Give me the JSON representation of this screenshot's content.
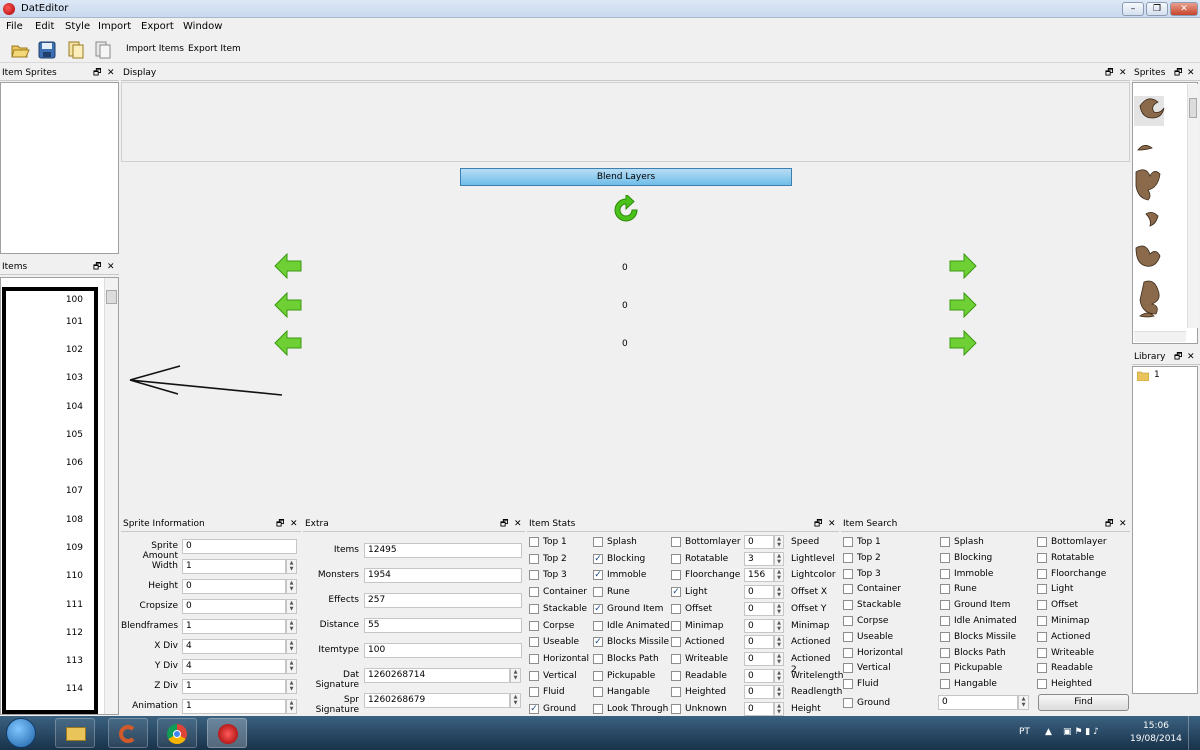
{
  "window": {
    "title": "DatEditor",
    "min_btn": "–",
    "max_btn": "❐",
    "close_btn": "✕"
  },
  "menu": [
    "File",
    "Edit",
    "Style",
    "Import",
    "Export",
    "Window"
  ],
  "toolbar": {
    "import_items": "Import Items",
    "export_item": "Export Item"
  },
  "panels": {
    "item_sprites": "Item Sprites",
    "items": "Items",
    "display": "Display",
    "sprites": "Sprites",
    "library": "Library",
    "sprite_information": "Sprite Information",
    "extra": "Extra",
    "item_stats": "Item Stats",
    "item_search": "Item Search"
  },
  "items_list": [
    "100",
    "101",
    "102",
    "103",
    "104",
    "105",
    "106",
    "107",
    "108",
    "109",
    "110",
    "111",
    "112",
    "113",
    "114"
  ],
  "display": {
    "blend_layers": "Blend Layers",
    "row_values": [
      "0",
      "0",
      "0"
    ]
  },
  "library": {
    "folder_name": "1"
  },
  "sprite_info": [
    {
      "label": "Sprite Amount",
      "value": "0",
      "spin": false
    },
    {
      "label": "Width",
      "value": "1",
      "spin": true
    },
    {
      "label": "Height",
      "value": "0",
      "spin": true
    },
    {
      "label": "Cropsize",
      "value": "0",
      "spin": true
    },
    {
      "label": "Blendframes",
      "value": "1",
      "spin": true
    },
    {
      "label": "X Div",
      "value": "4",
      "spin": true
    },
    {
      "label": "Y Div",
      "value": "4",
      "spin": true
    },
    {
      "label": "Z Div",
      "value": "1",
      "spin": true
    },
    {
      "label": "Animation",
      "value": "1",
      "spin": true
    }
  ],
  "extra": [
    {
      "label": "Items",
      "value": "12495",
      "spin": false
    },
    {
      "label": "Monsters",
      "value": "1954",
      "spin": false
    },
    {
      "label": "Effects",
      "value": "257",
      "spin": false
    },
    {
      "label": "Distance",
      "value": "55",
      "spin": false
    },
    {
      "label": "Itemtype",
      "value": "100",
      "spin": false
    },
    {
      "label": "Dat Signature",
      "value": "1260268714",
      "spin": true
    },
    {
      "label": "Spr Signature",
      "value": "1260268679",
      "spin": true
    }
  ],
  "item_stats": {
    "col1": [
      {
        "label": "Top 1",
        "checked": false
      },
      {
        "label": "Top 2",
        "checked": false
      },
      {
        "label": "Top 3",
        "checked": false
      },
      {
        "label": "Container",
        "checked": false
      },
      {
        "label": "Stackable",
        "checked": false
      },
      {
        "label": "Corpse",
        "checked": false
      },
      {
        "label": "Useable",
        "checked": false
      },
      {
        "label": "Horizontal",
        "checked": false
      },
      {
        "label": "Vertical",
        "checked": false
      },
      {
        "label": "Fluid",
        "checked": false
      },
      {
        "label": "Ground",
        "checked": true
      }
    ],
    "col2": [
      {
        "label": "Splash",
        "checked": false
      },
      {
        "label": "Blocking",
        "checked": true
      },
      {
        "label": "Immoble",
        "checked": true
      },
      {
        "label": "Rune",
        "checked": false
      },
      {
        "label": "Ground Item",
        "checked": true
      },
      {
        "label": "Idle Animated",
        "checked": false
      },
      {
        "label": "Blocks Missile",
        "checked": true
      },
      {
        "label": "Blocks Path",
        "checked": false
      },
      {
        "label": "Pickupable",
        "checked": false
      },
      {
        "label": "Hangable",
        "checked": false
      },
      {
        "label": "Look Through",
        "checked": false
      }
    ],
    "col3": [
      {
        "label": "Bottomlayer",
        "checked": false,
        "value": "0",
        "field": "Speed"
      },
      {
        "label": "Rotatable",
        "checked": false,
        "value": "3",
        "field": "Lightlevel"
      },
      {
        "label": "Floorchange",
        "checked": false,
        "value": "156",
        "field": "Lightcolor"
      },
      {
        "label": "Light",
        "checked": true,
        "value": "0",
        "field": "Offset X"
      },
      {
        "label": "Offset",
        "checked": false,
        "value": "0",
        "field": "Offset Y"
      },
      {
        "label": "Minimap",
        "checked": false,
        "value": "0",
        "field": "Minimap"
      },
      {
        "label": "Actioned",
        "checked": false,
        "value": "0",
        "field": "Actioned"
      },
      {
        "label": "Writeable",
        "checked": false,
        "value": "0",
        "field": "Actioned 2"
      },
      {
        "label": "Readable",
        "checked": false,
        "value": "0",
        "field": "Writelength"
      },
      {
        "label": "Heighted",
        "checked": false,
        "value": "0",
        "field": "Readlength"
      },
      {
        "label": "Unknown",
        "checked": false,
        "value": "0",
        "field": "Height"
      }
    ]
  },
  "item_search": {
    "col1": [
      "Top 1",
      "Top 2",
      "Top 3",
      "Container",
      "Stackable",
      "Corpse",
      "Useable",
      "Horizontal",
      "Vertical",
      "Fluid"
    ],
    "col2": [
      "Splash",
      "Blocking",
      "Immoble",
      "Rune",
      "Ground Item",
      "Idle Animated",
      "Blocks Missile",
      "Blocks Path",
      "Pickupable",
      "Hangable"
    ],
    "col3": [
      "Bottomlayer",
      "Rotatable",
      "Floorchange",
      "Light",
      "Offset",
      "Minimap",
      "Actioned",
      "Writeable",
      "Readable",
      "Heighted"
    ],
    "ground_label": "Ground",
    "ground_value": "0",
    "find_button": "Find"
  },
  "taskbar": {
    "language": "PT",
    "time": "15:06",
    "date": "19/08/2014"
  },
  "colors": {
    "accent_blue": "#5db7ea",
    "arrow_green": "#4ac21a",
    "annotation_black": "#000000"
  }
}
